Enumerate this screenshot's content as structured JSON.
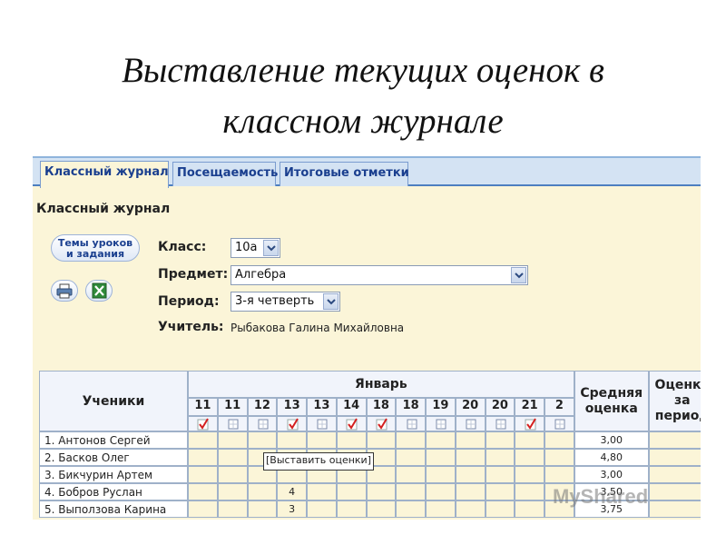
{
  "slide": {
    "title_line1": "Выставление текущих оценок в",
    "title_line2": "классном журнале"
  },
  "tabs": [
    {
      "label": "Классный журнал",
      "active": true
    },
    {
      "label": "Посещаемость",
      "active": false
    },
    {
      "label": "Итоговые отметки",
      "active": false
    }
  ],
  "page_title": "Классный журнал",
  "buttons": {
    "topics_line1": "Темы уроков",
    "topics_line2": "и задания",
    "print_icon": "printer-icon",
    "excel_icon": "excel-icon"
  },
  "form": {
    "class_label": "Класс:",
    "class_value": "10а",
    "subject_label": "Предмет:",
    "subject_value": "Алгебра",
    "period_label": "Период:",
    "period_value": "3-я четверть",
    "teacher_label": "Учитель:",
    "teacher_value": "Рыбакова Галина Михайловна"
  },
  "table": {
    "students_header": "Ученики",
    "month": "Январь",
    "days": [
      "11",
      "11",
      "12",
      "13",
      "13",
      "14",
      "18",
      "18",
      "19",
      "20",
      "20",
      "21",
      "2"
    ],
    "day_checked": [
      true,
      false,
      false,
      true,
      false,
      true,
      true,
      false,
      false,
      false,
      false,
      true,
      false
    ],
    "avg_header_line1": "Средняя",
    "avg_header_line2": "оценка",
    "period_header_line1": "Оценка",
    "period_header_line2": "за",
    "period_header_line3": "период",
    "rows": [
      {
        "name": "1. Антонов Сергей",
        "marks": [
          "",
          "",
          "",
          "",
          "",
          "",
          "",
          "",
          "",
          "",
          "",
          "",
          ""
        ],
        "avg": "3,00"
      },
      {
        "name": "2. Басков Олег",
        "marks": [
          "",
          "",
          "",
          "",
          "",
          "",
          "",
          "",
          "",
          "",
          "",
          "",
          ""
        ],
        "avg": "4,80"
      },
      {
        "name": "3. Бикчурин Артем",
        "marks": [
          "",
          "",
          "",
          "",
          "",
          "",
          "",
          "",
          "",
          "",
          "",
          "",
          ""
        ],
        "avg": "3,00"
      },
      {
        "name": "4. Бобров Руслан",
        "marks": [
          "",
          "",
          "",
          "4",
          "",
          "",
          "",
          "",
          "",
          "",
          "",
          "",
          ""
        ],
        "avg": "3,50"
      },
      {
        "name": "5. Выползова Карина",
        "marks": [
          "",
          "",
          "",
          "3",
          "",
          "",
          "",
          "",
          "",
          "",
          "",
          "",
          ""
        ],
        "avg": "3,75"
      }
    ],
    "tooltip": "[Выставить оценки]"
  },
  "watermark": "MyShared",
  "colors": {
    "panel_bg": "#fbf5d8",
    "tab_bg": "#d4e3f3",
    "tab_text": "#1a3f8f",
    "check_red": "#d42020",
    "grid_border": "#9fb1c9"
  }
}
